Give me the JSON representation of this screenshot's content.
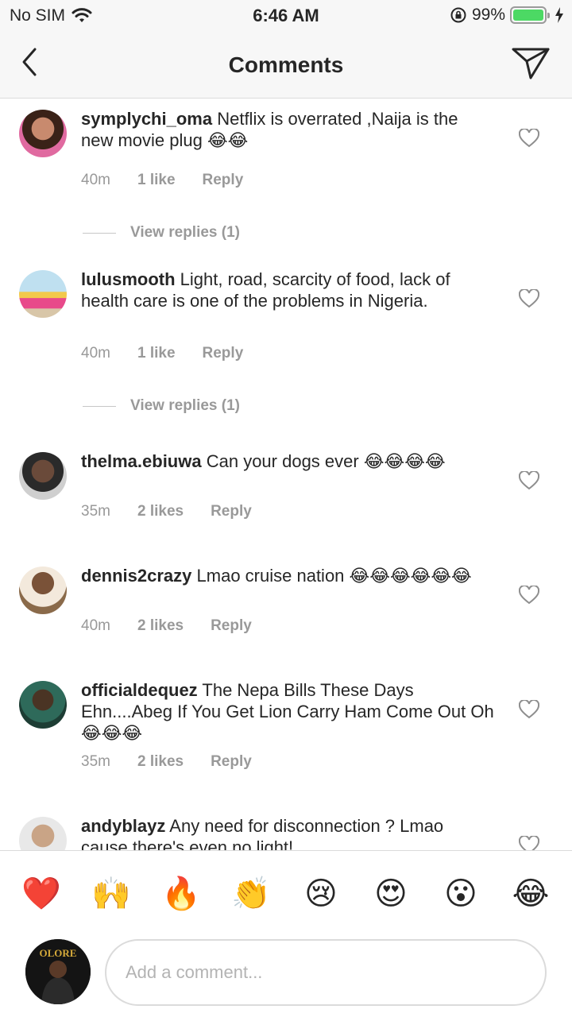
{
  "status_bar": {
    "carrier": "No SIM",
    "time": "6:46 AM",
    "battery_percent": "99%",
    "battery_level": 0.99,
    "icons": [
      "wifi-icon",
      "orientation-lock-icon",
      "battery-icon",
      "charging-bolt-icon"
    ]
  },
  "nav": {
    "title": "Comments",
    "back_icon": "chevron-left-icon",
    "share_icon": "paper-plane-icon"
  },
  "comments": [
    {
      "username": "symplychi_oma",
      "text": "Netflix is overrated ,Naija is the new movie plug 😂😂",
      "time": "40m",
      "likes": "1 like",
      "reply": "Reply",
      "view_replies": "View replies (1)"
    },
    {
      "username": "lulusmooth",
      "text": "Light, road, scarcity of food, lack of health care is one of the problems in Nigeria.",
      "time": "40m",
      "likes": "1 like",
      "reply": "Reply",
      "view_replies": "View replies (1)"
    },
    {
      "username": "thelma.ebiuwa",
      "text": "Can your dogs ever 😂😂😂😂",
      "time": "35m",
      "likes": "2 likes",
      "reply": "Reply"
    },
    {
      "username": "dennis2crazy",
      "text": "Lmao cruise nation 😂😂😂😂😂😂",
      "time": "40m",
      "likes": "2 likes",
      "reply": "Reply"
    },
    {
      "username": "officialdequez",
      "text": "The Nepa Bills These Days Ehn....Abeg If You Get Lion Carry Ham Come Out Oh😂😂😂",
      "time": "35m",
      "likes": "2 likes",
      "reply": "Reply"
    },
    {
      "username": "andyblayz",
      "text": "Any need for disconnection ? Lmao cause there's even no light!"
    }
  ],
  "emoji_bar": [
    "❤️",
    "🙌",
    "🔥",
    "👏",
    "😢",
    "😍",
    "😮",
    "😂"
  ],
  "input": {
    "placeholder": "Add a comment...",
    "avatar_text": "OLORE"
  }
}
